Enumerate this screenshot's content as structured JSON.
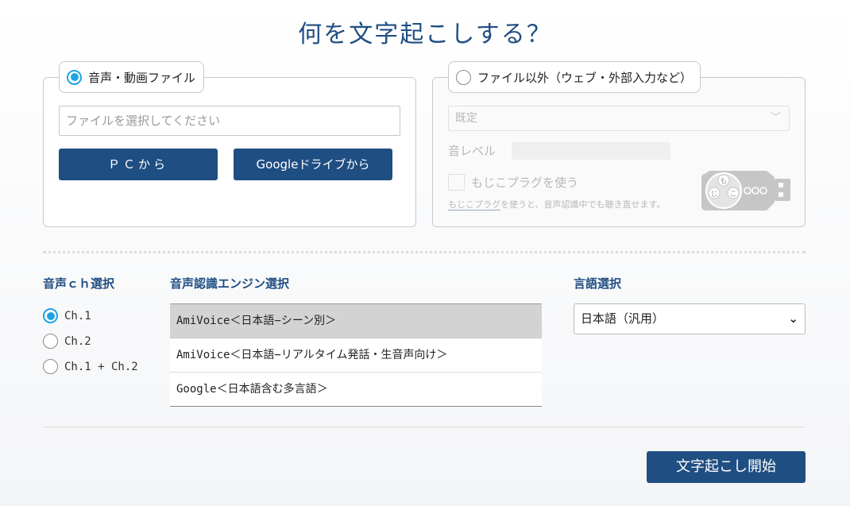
{
  "page_title": "何を文字起こしする？",
  "file_panel": {
    "legend": "音声・動画ファイル",
    "selected": true,
    "file_placeholder": "ファイルを選択してください",
    "pc_button": "ＰＣから",
    "gdrive_button": "Googleドライブから"
  },
  "other_panel": {
    "legend": "ファイル以外（ウェブ・外部入力など）",
    "selected": false,
    "device_select": "既定",
    "sound_level_label": "音レベル",
    "mojiko_checkbox_label": "もじこプラグを使う",
    "note_link": "もじこプラグ",
    "note_rest": "を使うと、音声認識中でも聴き直せます。",
    "plug_icon_letters": [
      "も",
      "じ",
      "こ"
    ]
  },
  "channel_section": {
    "title": "音声ｃｈ選択",
    "options": [
      "Ch.1",
      "Ch.2",
      "Ch.1 + Ch.2"
    ],
    "selected_index": 0
  },
  "engine_section": {
    "title": "音声認識エンジン選択",
    "engines": [
      "AmiVoice＜日本語−シーン別＞",
      "AmiVoice＜日本語−リアルタイム発話・生音声向け＞",
      "Google＜日本語含む多言語＞"
    ],
    "selected_index": 0
  },
  "language_section": {
    "title": "言語選択",
    "selected_value": "日本語（汎用）"
  },
  "start_button": "文字起こし開始",
  "colors": {
    "primary": "#1f4e82",
    "radio_accent": "#1ea4e0"
  }
}
